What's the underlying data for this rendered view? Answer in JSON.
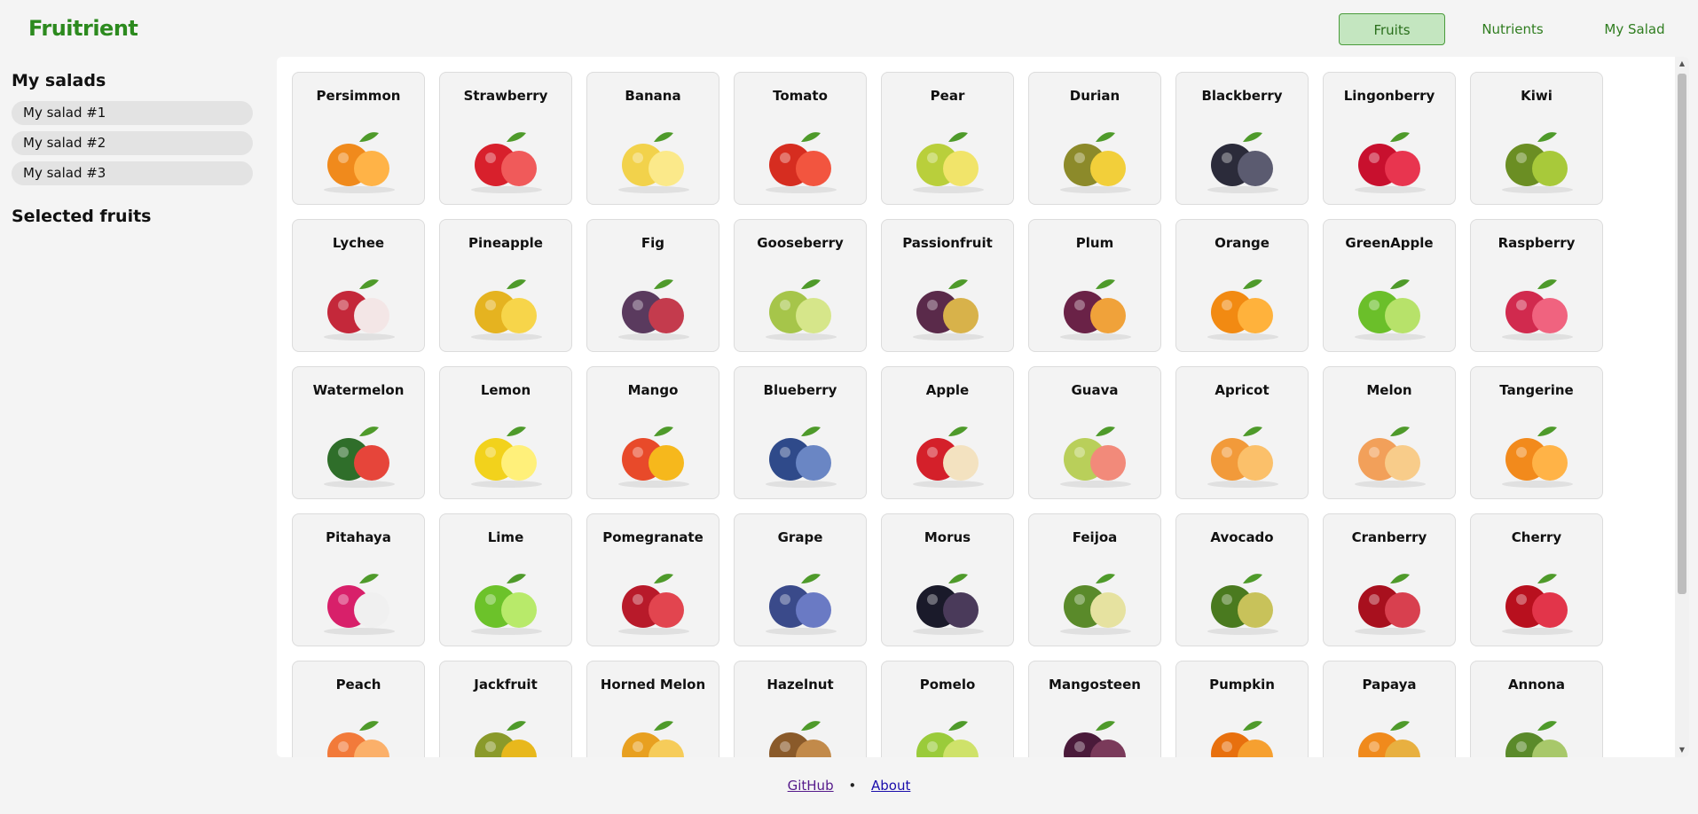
{
  "brand": "Fruitrient",
  "nav": {
    "fruits": "Fruits",
    "nutrients": "Nutrients",
    "my_salad": "My Salad"
  },
  "sidebar": {
    "heading": "My salads",
    "salads": [
      "My salad #1",
      "My salad #2",
      "My salad #3"
    ],
    "selected_heading": "Selected fruits"
  },
  "fruits": [
    "Persimmon",
    "Strawberry",
    "Banana",
    "Tomato",
    "Pear",
    "Durian",
    "Blackberry",
    "Lingonberry",
    "Kiwi",
    "Lychee",
    "Pineapple",
    "Fig",
    "Gooseberry",
    "Passionfruit",
    "Plum",
    "Orange",
    "GreenApple",
    "Raspberry",
    "Watermelon",
    "Lemon",
    "Mango",
    "Blueberry",
    "Apple",
    "Guava",
    "Apricot",
    "Melon",
    "Tangerine",
    "Pitahaya",
    "Lime",
    "Pomegranate",
    "Grape",
    "Morus",
    "Feijoa",
    "Avocado",
    "Cranberry",
    "Cherry",
    "Peach",
    "Jackfruit",
    "Horned Melon",
    "Hazelnut",
    "Pomelo",
    "Mangosteen",
    "Pumpkin",
    "Papaya",
    "Annona"
  ],
  "footer": {
    "github": "GitHub",
    "separator": "•",
    "about": "About"
  }
}
